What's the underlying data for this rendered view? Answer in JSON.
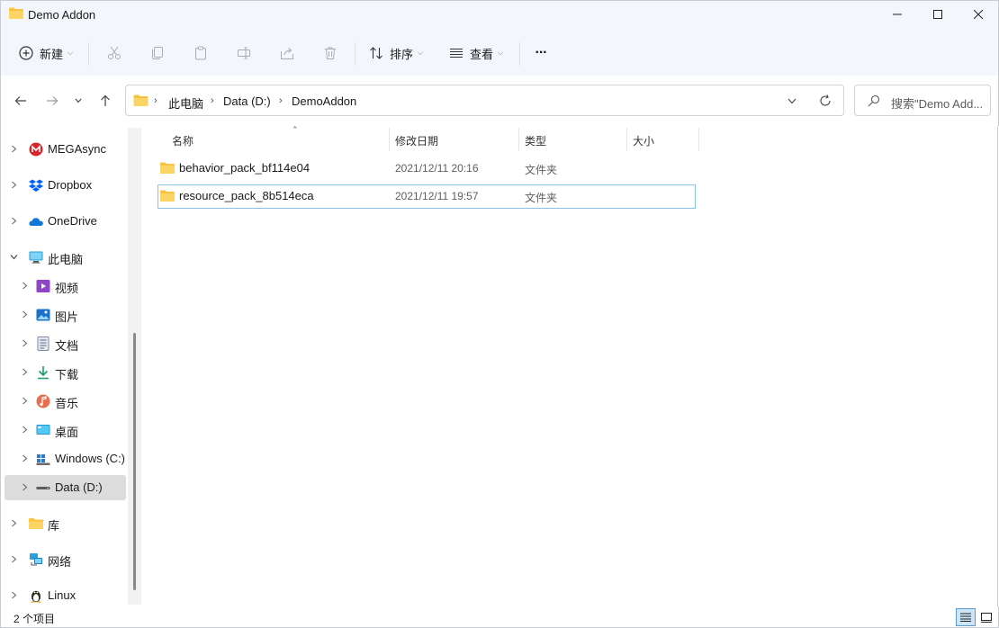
{
  "window": {
    "title": "Demo Addon",
    "controls": [
      "minimize",
      "maximize",
      "close"
    ]
  },
  "toolbar": {
    "new_label": "新建",
    "sort_label": "排序",
    "view_label": "查看",
    "more_label": "···",
    "icons": [
      "plus-circle",
      "cut",
      "copy",
      "paste",
      "rename",
      "share",
      "delete",
      "sort",
      "view",
      "more"
    ]
  },
  "nav": {
    "breadcrumb": [
      "此电脑",
      "Data (D:)",
      "DemoAddon"
    ],
    "search_placeholder": "搜索\"Demo Add..."
  },
  "sidebar": {
    "items": [
      {
        "label": "MEGAsync",
        "icon": "mega-icon",
        "indent": 0,
        "expanded": false
      },
      {
        "label": "Dropbox",
        "icon": "dropbox-icon",
        "indent": 0,
        "expanded": false
      },
      {
        "label": "OneDrive",
        "icon": "onedrive-icon",
        "indent": 0,
        "expanded": false
      },
      {
        "label": "此电脑",
        "icon": "computer-icon",
        "indent": 0,
        "expanded": true
      },
      {
        "label": "视频",
        "icon": "video-icon",
        "indent": 1,
        "expanded": false
      },
      {
        "label": "图片",
        "icon": "pictures-icon",
        "indent": 1,
        "expanded": false
      },
      {
        "label": "文档",
        "icon": "documents-icon",
        "indent": 1,
        "expanded": false
      },
      {
        "label": "下载",
        "icon": "download-icon",
        "indent": 1,
        "expanded": false
      },
      {
        "label": "音乐",
        "icon": "music-icon",
        "indent": 1,
        "expanded": false
      },
      {
        "label": "桌面",
        "icon": "desktop-icon",
        "indent": 1,
        "expanded": false
      },
      {
        "label": "Windows (C:)",
        "icon": "windows-drive-icon",
        "indent": 1,
        "expanded": false
      },
      {
        "label": "Data (D:)",
        "icon": "drive-icon",
        "indent": 1,
        "expanded": false,
        "selected": true
      },
      {
        "label": "库",
        "icon": "library-icon",
        "indent": 0,
        "expanded": false
      },
      {
        "label": "网络",
        "icon": "network-icon",
        "indent": 0,
        "expanded": false
      },
      {
        "label": "Linux",
        "icon": "linux-icon",
        "indent": 0,
        "expanded": false
      }
    ]
  },
  "columns": [
    "名称",
    "修改日期",
    "类型",
    "大小"
  ],
  "files": [
    {
      "name": "behavior_pack_bf114e04",
      "date": "2021/12/11 20:16",
      "type": "文件夹",
      "size": ""
    },
    {
      "name": "resource_pack_8b514eca",
      "date": "2021/12/11 19:57",
      "type": "文件夹",
      "size": ""
    }
  ],
  "status": {
    "item_count": "2 个项目"
  },
  "colors": {
    "chrome_bg": "#f3f6fb",
    "folder_yellow": "#f8c440",
    "focus_border": "#86c5e8",
    "selected_bg": "#dcdcdc"
  }
}
